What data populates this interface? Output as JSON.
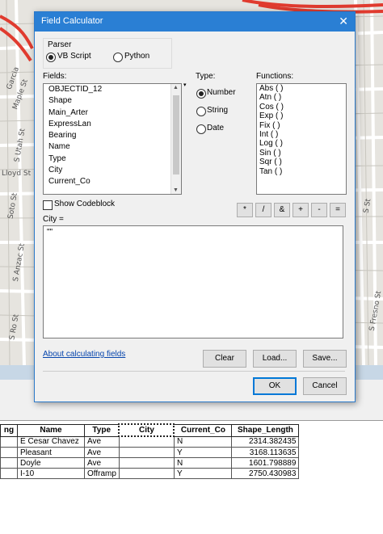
{
  "dialog": {
    "title": "Field Calculator",
    "close_glyph": "✕",
    "parser_label": "Parser",
    "parser_options": [
      "VB Script",
      "Python"
    ],
    "parser_selected": "VB Script",
    "fields_label": "Fields:",
    "fields": [
      "OBJECTID_12",
      "Shape",
      "Main_Arter",
      "ExpressLan",
      "Bearing",
      "Name",
      "Type",
      "City",
      "Current_Co"
    ],
    "type_label": "Type:",
    "type_options": [
      "Number",
      "String",
      "Date"
    ],
    "type_selected": "Number",
    "functions_label": "Functions:",
    "functions": [
      "Abs ( )",
      "Atn ( )",
      "Cos ( )",
      "Exp ( )",
      "Fix ( )",
      "Int ( )",
      "Log ( )",
      "Sin ( )",
      "Sqr ( )",
      "Tan ( )"
    ],
    "show_codeblock_label": "Show Codeblock",
    "operators": [
      "*",
      "/",
      "&",
      "+",
      "-",
      "="
    ],
    "expression_label": "City =",
    "expression_value": "\"\"",
    "about_link": "About calculating fields",
    "clear_label": "Clear",
    "load_label": "Load...",
    "save_label": "Save...",
    "ok_label": "OK",
    "cancel_label": "Cancel"
  },
  "map": {
    "street_labels": [
      "Garcia",
      "Maple St",
      "S Utah St",
      "Lloyd St",
      "Soto St",
      "S Anzac St",
      "S Ro St",
      "S Fresno St",
      "S St"
    ]
  },
  "table": {
    "headers": [
      "ng",
      "Name",
      "Type",
      "City",
      "Current_Co",
      "Shape_Length"
    ],
    "rows": [
      [
        "",
        "E Cesar Chavez",
        "Ave",
        "",
        "N",
        "2314.382435"
      ],
      [
        "",
        "Pleasant",
        "Ave",
        "",
        "Y",
        "3168.113635"
      ],
      [
        "",
        "Doyle",
        "Ave",
        "",
        "N",
        "1601.798889"
      ],
      [
        "",
        "I-10",
        "Offramp",
        "",
        "Y",
        "2750.430983"
      ]
    ]
  },
  "colors": {
    "titlebar": "#2a7fd4",
    "link": "#0645ad",
    "freeway": "#e03b2f"
  }
}
